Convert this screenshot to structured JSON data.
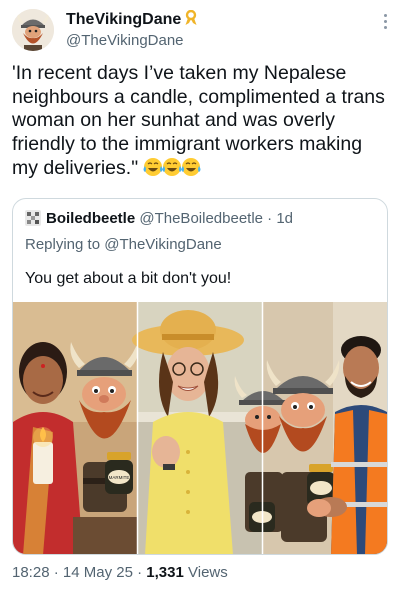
{
  "author": {
    "display_name": "TheVikingDane",
    "handle": "@TheVikingDane",
    "badge_icon": "gold-ribbon-icon"
  },
  "tweet": {
    "text": "'In recent days I’ve taken my Nepalese neighbours a candle, complimented a trans woman on her sunhat and was overly friendly to the immigrant workers making my deliveries.\"",
    "emoji_icons": [
      "tears-of-joy-icon",
      "tears-of-joy-icon",
      "tears-of-joy-icon"
    ]
  },
  "quoted_tweet": {
    "display_name": "Boiledbeetle",
    "handle": "@TheBoiledbeetle",
    "separator": "·",
    "age": "1d",
    "replying_prefix": "Replying to",
    "replying_to": "@TheVikingDane",
    "text": "You get about a bit don't you!",
    "image_panels": [
      "woman-with-candle-and-viking",
      "woman-in-sunhat-with-viking",
      "vikings-shaking-hands-with-worker"
    ],
    "jar_label": "MARMITE"
  },
  "footer": {
    "time": "18:28",
    "date": "14 May 25",
    "separator": "·",
    "views_count": "1,331",
    "views_label": "Views"
  },
  "colors": {
    "text_primary": "#0f1419",
    "text_secondary": "#536471",
    "border": "#cfd9de",
    "ribbon": "#f0b429",
    "vest_orange": "#f47a20"
  }
}
